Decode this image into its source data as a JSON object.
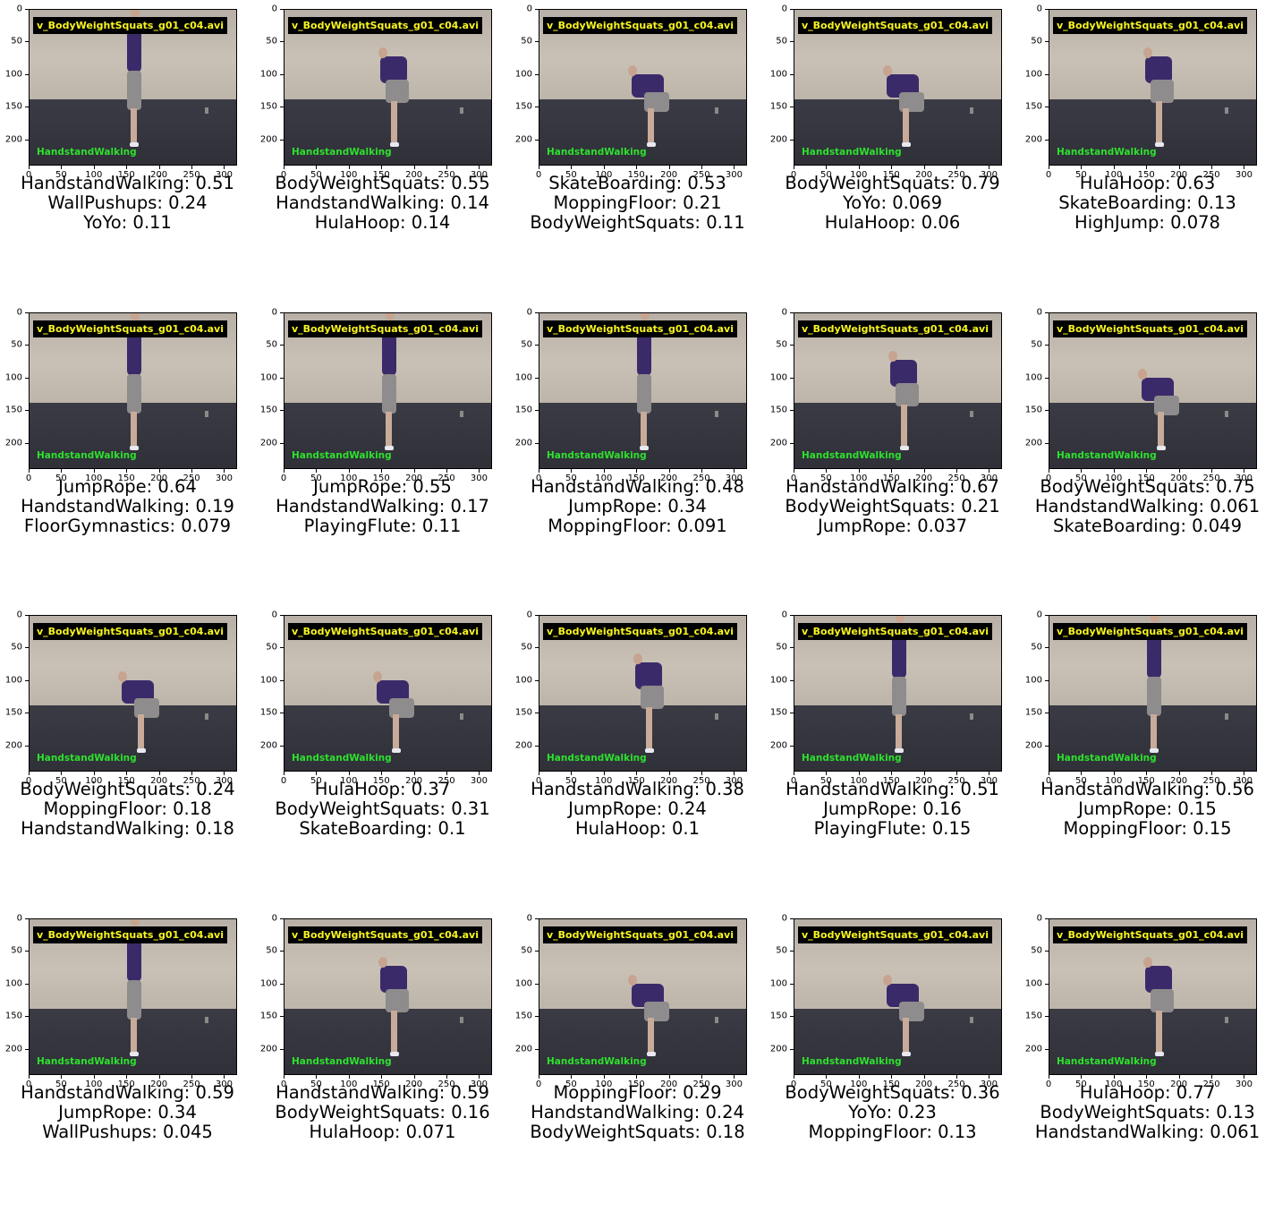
{
  "video_caption": "v_BodyWeightSquats_g01_c04.avi",
  "overlay_prediction": "HandstandWalking",
  "colors": {
    "caption_text": "#f7f520",
    "caption_bg": "#000000",
    "overlay_text": "#2ee02e"
  },
  "x_ticks": [
    "0",
    "50",
    "100",
    "150",
    "200",
    "250",
    "300"
  ],
  "y_ticks": [
    "0",
    "50",
    "100",
    "150",
    "200"
  ],
  "panels": [
    {
      "pose": "stand-arms",
      "labels": [
        "HandstandWalking: 0.51",
        "WallPushups: 0.24",
        "YoYo: 0.11"
      ]
    },
    {
      "pose": "squat",
      "labels": [
        "BodyWeightSquats: 0.55",
        "HandstandWalking: 0.14",
        "HulaHoop: 0.14"
      ]
    },
    {
      "pose": "deep-squat",
      "labels": [
        "SkateBoarding: 0.53",
        "MoppingFloor: 0.21",
        "BodyWeightSquats: 0.11"
      ]
    },
    {
      "pose": "deep-squat",
      "labels": [
        "BodyWeightSquats: 0.79",
        "YoYo: 0.069",
        "HulaHoop: 0.06"
      ]
    },
    {
      "pose": "squat",
      "labels": [
        "HulaHoop: 0.63",
        "SkateBoarding: 0.13",
        "HighJump: 0.078"
      ]
    },
    {
      "pose": "stand",
      "labels": [
        "JumpRope: 0.64",
        "HandstandWalking: 0.19",
        "FloorGymnastics: 0.079"
      ]
    },
    {
      "pose": "stand",
      "labels": [
        "JumpRope: 0.55",
        "HandstandWalking: 0.17",
        "PlayingFlute: 0.11"
      ]
    },
    {
      "pose": "stand",
      "labels": [
        "HandstandWalking: 0.48",
        "JumpRope: 0.34",
        "MoppingFloor: 0.091"
      ]
    },
    {
      "pose": "squat",
      "labels": [
        "HandstandWalking: 0.67",
        "BodyWeightSquats: 0.21",
        "JumpRope: 0.037"
      ]
    },
    {
      "pose": "deep-squat",
      "labels": [
        "BodyWeightSquats: 0.75",
        "HandstandWalking: 0.061",
        "SkateBoarding: 0.049"
      ]
    },
    {
      "pose": "deep-squat",
      "labels": [
        "BodyWeightSquats: 0.24",
        "MoppingFloor: 0.18",
        "HandstandWalking: 0.18"
      ]
    },
    {
      "pose": "deep-squat",
      "labels": [
        "HulaHoop: 0.37",
        "BodyWeightSquats: 0.31",
        "SkateBoarding: 0.1"
      ]
    },
    {
      "pose": "squat",
      "labels": [
        "HandstandWalking: 0.38",
        "JumpRope: 0.24",
        "HulaHoop: 0.1"
      ]
    },
    {
      "pose": "stand",
      "labels": [
        "HandstandWalking: 0.51",
        "JumpRope: 0.16",
        "PlayingFlute: 0.15"
      ]
    },
    {
      "pose": "stand",
      "labels": [
        "HandstandWalking: 0.56",
        "JumpRope: 0.15",
        "MoppingFloor: 0.15"
      ]
    },
    {
      "pose": "stand",
      "labels": [
        "HandstandWalking: 0.59",
        "JumpRope: 0.34",
        "WallPushups: 0.045"
      ]
    },
    {
      "pose": "squat",
      "labels": [
        "HandstandWalking: 0.59",
        "BodyWeightSquats: 0.16",
        "HulaHoop: 0.071"
      ]
    },
    {
      "pose": "deep-squat",
      "labels": [
        "MoppingFloor: 0.29",
        "HandstandWalking: 0.24",
        "BodyWeightSquats: 0.18"
      ]
    },
    {
      "pose": "deep-squat",
      "labels": [
        "BodyWeightSquats: 0.36",
        "YoYo: 0.23",
        "MoppingFloor: 0.13"
      ]
    },
    {
      "pose": "squat",
      "labels": [
        "HulaHoop: 0.77",
        "BodyWeightSquats: 0.13",
        "HandstandWalking: 0.061"
      ]
    }
  ]
}
